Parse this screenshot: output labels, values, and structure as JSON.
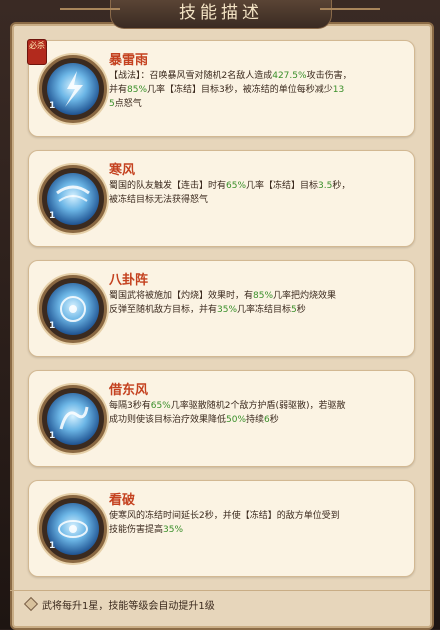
{
  "header": {
    "title": "技能描述"
  },
  "skills": [
    {
      "name": "暴雷雨",
      "badge": "必杀",
      "desc": [
        "【战法】：召唤暴风雪对随机2名敌人造成427.5%攻击伤害，",
        "并有85%几率【冻结】目标3秒，被冻结的单位每秒减少13",
        "5点怒气"
      ]
    },
    {
      "name": "寒风",
      "desc": [
        "蜀国的队友触发【连击】时有65%几率【冻结】目标3.5秒，",
        "被冻结目标无法获得怒气"
      ]
    },
    {
      "name": "八卦阵",
      "desc": [
        "蜀国武将被施加【灼烧】效果时，有85%几率把灼烧效果",
        "反弹至随机敌方目标，并有35%几率冻结目标5秒"
      ]
    },
    {
      "name": "借东风",
      "desc": [
        "每隔3秒有65%几率驱散随机2个敌方护盾(弱驱散)，若驱散",
        "成功则使该目标治疗效果降低50%持续6秒"
      ]
    },
    {
      "name": "看破",
      "desc": [
        "使寒风的冻结时间延长2秒，并使【冻结】的敌方单位受到",
        "技能伤害提高35%"
      ]
    }
  ],
  "icon_level": "1",
  "footer": {
    "text": "武将每升1星，技能等级会自动提升1级"
  },
  "colors": {
    "name": "#c4411f",
    "highlight": "#3a8f2a",
    "panel": "#e7d6bb",
    "card": "#fbf3e3"
  }
}
